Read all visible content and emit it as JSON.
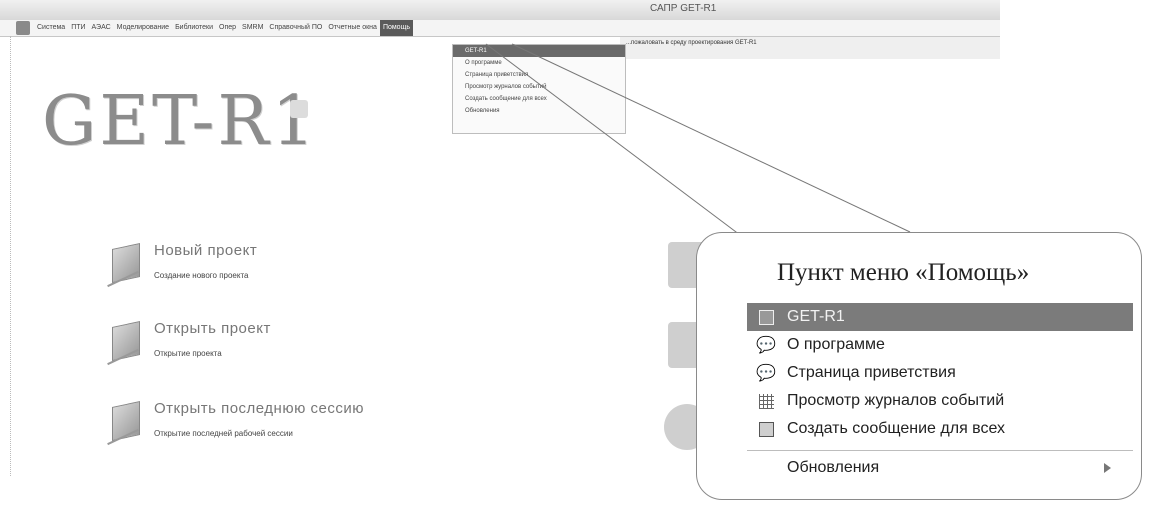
{
  "window": {
    "title": "САПР GET-R1"
  },
  "menubar": {
    "items": [
      "Система",
      "ПТИ",
      "АЭАС",
      "Моделирование",
      "Библиотеки",
      "Опер",
      "SMRM",
      "Справочный ПО",
      "Отчетные окна",
      "Помощь"
    ]
  },
  "banner": {
    "text": "...пожаловать в среду проектирования GET-R1"
  },
  "logo": {
    "text": "GET-R1"
  },
  "actions": [
    {
      "title": "Новый проект",
      "subtitle": "Создание нового проекта"
    },
    {
      "title": "Открыть проект",
      "subtitle": "Открытие проекта"
    },
    {
      "title": "Открыть последнюю сессию",
      "subtitle": "Открытие последней рабочей сессии"
    }
  ],
  "dropdown": {
    "items": [
      "GET-R1",
      "О программе",
      "Страница приветствия",
      "Просмотр журналов событий",
      "Создать сообщение для всех",
      "Обновления"
    ]
  },
  "callout": {
    "title": "Пункт меню «Помощь»",
    "items": [
      {
        "label": "GET-R1",
        "icon": "book-icon"
      },
      {
        "label": "О программе",
        "icon": "speech-bubble-icon"
      },
      {
        "label": "Страница приветствия",
        "icon": "speech-bubble-icon"
      },
      {
        "label": "Просмотр журналов событий",
        "icon": "grid-icon"
      },
      {
        "label": "Создать сообщение для всех",
        "icon": "book-icon"
      },
      {
        "label": "Обновления",
        "icon": "chevron-right-icon"
      }
    ]
  },
  "colors": {
    "selected": "#7b7b7b",
    "border": "#8a8a8a"
  }
}
